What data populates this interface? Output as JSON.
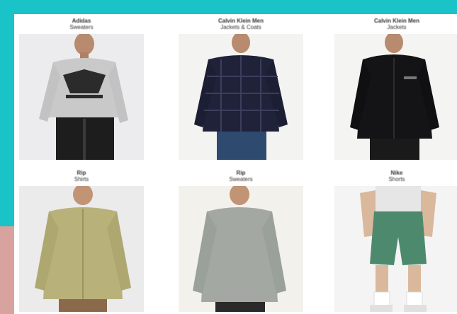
{
  "products": [
    {
      "brand": "Adidas",
      "category": "Sweaters"
    },
    {
      "brand": "Calvin Klein Men",
      "category": "Jackets & Coats"
    },
    {
      "brand": "Calvin Klein Men",
      "category": "Jackets"
    },
    {
      "brand": "Rip",
      "category": "Shirts"
    },
    {
      "brand": "Rip",
      "category": "Sweaters"
    },
    {
      "brand": "Nike",
      "category": "Shorts"
    }
  ],
  "colors": {
    "background": "#19c3c8",
    "accent_shape": "#d8a39e",
    "panel": "#ffffff"
  }
}
